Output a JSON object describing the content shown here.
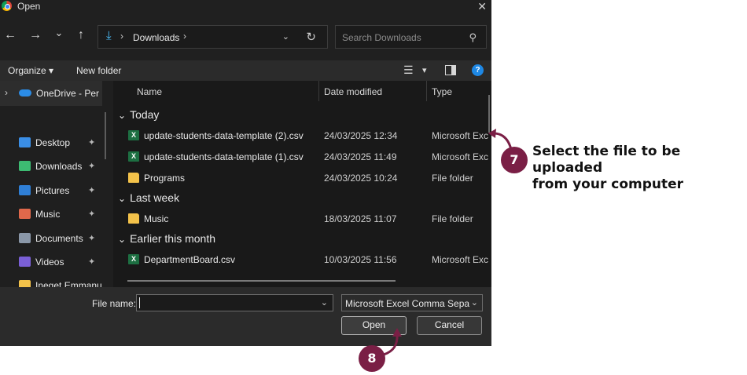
{
  "window": {
    "title": "Open",
    "close_glyph": "✕"
  },
  "nav": {
    "back": "←",
    "forward": "→",
    "recent": "⌄",
    "up": "↑",
    "path_root_chevron": "›",
    "path_current": "Downloads",
    "path_end_chevron": "›",
    "address_dropdown": "⌄",
    "refresh": "↻",
    "search_placeholder": "Search Downloads",
    "search_glyph": "⚲"
  },
  "toolbar": {
    "organize": "Organize ▾",
    "new_folder": "New folder",
    "view_glyph": "☰",
    "view_dropdown": "▾",
    "help": "?"
  },
  "sidebar": {
    "onedrive_expand": "›",
    "onedrive": "OneDrive - Perso",
    "pin_glyph": "✦",
    "items": [
      {
        "label": "Desktop",
        "icon": "desktop-icon",
        "color": "#3a8ee6"
      },
      {
        "label": "Downloads",
        "icon": "downloads-icon",
        "color": "#3dbb72"
      },
      {
        "label": "Pictures",
        "icon": "pictures-icon",
        "color": "#2f7fd6"
      },
      {
        "label": "Music",
        "icon": "music-icon",
        "color": "#e0684b"
      },
      {
        "label": "Documents",
        "icon": "documents-icon",
        "color": "#8a97a8"
      },
      {
        "label": "Videos",
        "icon": "videos-icon",
        "color": "#7a5fd6"
      },
      {
        "label": "Ineget Emmanu",
        "icon": "folder-icon",
        "color": "#f3c24a"
      }
    ]
  },
  "columns": {
    "name": "Name",
    "date": "Date modified",
    "type": "Type",
    "sort_glyph": "⌃"
  },
  "groups": [
    {
      "label": "Today",
      "files": [
        {
          "name": "update-students-data-template (2).csv",
          "date": "24/03/2025 12:34",
          "type": "Microsoft Exc",
          "kind": "excel"
        },
        {
          "name": "update-students-data-template (1).csv",
          "date": "24/03/2025 11:49",
          "type": "Microsoft Exc",
          "kind": "excel"
        },
        {
          "name": "Programs",
          "date": "24/03/2025 10:24",
          "type": "File folder",
          "kind": "folder"
        }
      ]
    },
    {
      "label": "Last week",
      "files": [
        {
          "name": "Music",
          "date": "18/03/2025 11:07",
          "type": "File folder",
          "kind": "folder"
        }
      ]
    },
    {
      "label": "Earlier this month",
      "files": [
        {
          "name": "DepartmentBoard.csv",
          "date": "10/03/2025 11:56",
          "type": "Microsoft Exc",
          "kind": "excel"
        }
      ]
    }
  ],
  "group_chevron": "⌄",
  "excel_glyph": "X",
  "footer": {
    "file_name_label": "File name:",
    "file_name_value": "",
    "file_name_dropdown": "⌄",
    "file_type": "Microsoft Excel Comma Separa",
    "file_type_dropdown": "⌄",
    "open": "Open",
    "cancel": "Cancel"
  },
  "annotations": {
    "step7_number": "7",
    "step7_line1": "Select the file to be uploaded",
    "step7_line2": "from your computer",
    "step8_number": "8",
    "badge_color": "#7a1f45"
  }
}
